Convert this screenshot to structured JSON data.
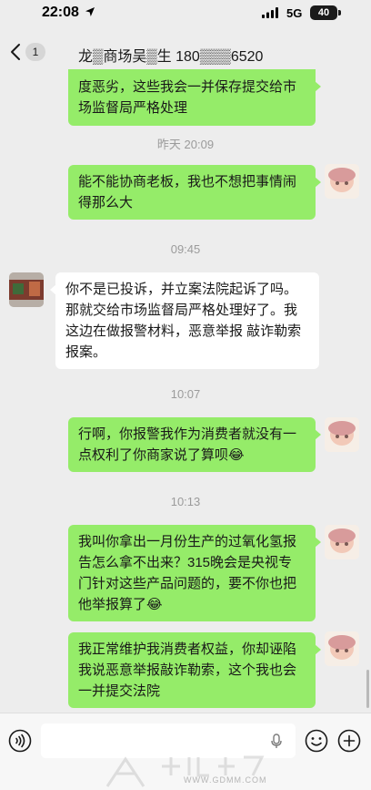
{
  "status_bar": {
    "time": "22:08",
    "network": "5G",
    "battery": "40"
  },
  "header": {
    "unread_count": "1",
    "title": "龙▒商场吴▒生 180▒▒▒6520"
  },
  "messages": [
    {
      "type": "bubble",
      "side": "out",
      "text": "度恶劣，这些我会一并保存提交给市场监督局严格处理"
    },
    {
      "type": "time",
      "text": "昨天 20:09"
    },
    {
      "type": "bubble",
      "side": "out",
      "text": "能不能协商老板，我也不想把事情闹得那么大"
    },
    {
      "type": "time",
      "text": "09:45"
    },
    {
      "type": "bubble",
      "side": "in",
      "text": "你不是已投诉，并立案法院起诉了吗。那就交给市场监督局严格处理好了。我这边在做报警材料，恶意举报 敲诈勒索报案。"
    },
    {
      "type": "time",
      "text": "10:07"
    },
    {
      "type": "bubble",
      "side": "out",
      "text": "行啊，你报警我作为消费者就没有一点权利了你商家说了算呗😂"
    },
    {
      "type": "time",
      "text": "10:13"
    },
    {
      "type": "bubble",
      "side": "out",
      "text": "我叫你拿出一月份生产的过氧化氢报告怎么拿不出来？315晚会是央视专门针对这些产品问题的，要不你也把他举报算了😂"
    },
    {
      "type": "bubble",
      "side": "out",
      "text": "我正常维护我消费者权益，你却诬陷我说恶意举报敲诈勒索，这个我也会一并提交法院"
    }
  ],
  "watermark": {
    "url": "WWW.GDMM.COM"
  },
  "icons": {
    "back": "chevron-left-icon",
    "voice": "voice-icon",
    "mic": "mic-icon",
    "emoji": "emoji-icon",
    "plus": "plus-icon"
  },
  "colors": {
    "background": "#ededed",
    "outgoing_bubble": "#95ec69",
    "incoming_bubble": "#ffffff",
    "timestamp": "#9b9b9b"
  }
}
